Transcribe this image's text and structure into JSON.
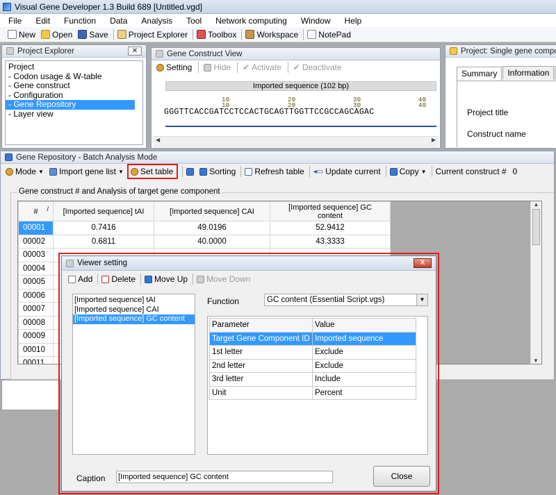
{
  "window": {
    "title": "Visual Gene Developer 1.3  Build 689  [Untitled.vgd]"
  },
  "menu": [
    "File",
    "Edit",
    "Function",
    "Data",
    "Analysis",
    "Tool",
    "Network computing",
    "Window",
    "Help"
  ],
  "toolbar": {
    "new": "New",
    "open": "Open",
    "save": "Save",
    "project_explorer": "Project Explorer",
    "toolbox": "Toolbox",
    "workspace": "Workspace",
    "notepad": "NotePad"
  },
  "project_explorer": {
    "title": "Project Explorer",
    "close": "✕",
    "items": [
      "Project",
      " - Codon usage & W-table",
      " - Gene construct",
      " - Configuration",
      " - Gene Repository",
      " - Layer view"
    ]
  },
  "gene_construct_view": {
    "title": "Gene Construct View",
    "tools": {
      "setting": "Setting",
      "hide": "Hide",
      "activate": "Activate",
      "deactivate": "Deactivate"
    },
    "sequence_label": "Imported sequence (102 bp)",
    "ruler_top": [
      "10",
      "20",
      "30",
      "40"
    ],
    "ruler_bottom": [
      "10",
      "20",
      "30",
      "40"
    ],
    "sequence": "GGGTTCACCGATCCTCCACTGCAGTTGGTTCCGCCAGCAGAC"
  },
  "project_panel": {
    "title": "Project:  Single gene compone",
    "tabs": [
      "Summary",
      "Information",
      "Sa"
    ],
    "fields": {
      "project_title": "Project title",
      "construct_name": "Construct name"
    }
  },
  "gene_repository": {
    "title": "Gene Repository - Batch Analysis Mode",
    "tools": {
      "mode": "Mode",
      "import_gene_list": "Import gene list",
      "set_table": "Set table",
      "sorting": "Sorting",
      "refresh_table": "Refresh table",
      "update_current": "Update current",
      "copy": "Copy",
      "current_construct": "Current construct #",
      "current_construct_value": "0"
    },
    "group_label": "Gene construct # and  Analysis of target gene component",
    "columns": {
      "num": "#",
      "sort": "/",
      "tai": "[Imported sequence] tAI",
      "cai": "[Imported sequence] CAI",
      "gc": "[Imported sequence] GC content"
    },
    "rows": [
      {
        "id": "00001",
        "tai": "0.7416",
        "cai": "49.0196",
        "gc": "52.9412"
      },
      {
        "id": "00002",
        "tai": "0.6811",
        "cai": "40.0000",
        "gc": "43.3333"
      },
      {
        "id": "00003",
        "tai": "",
        "cai": "",
        "gc": ""
      },
      {
        "id": "00004",
        "tai": "",
        "cai": "",
        "gc": ""
      },
      {
        "id": "00005",
        "tai": "",
        "cai": "",
        "gc": ""
      },
      {
        "id": "00006",
        "tai": "",
        "cai": "",
        "gc": ""
      },
      {
        "id": "00007",
        "tai": "",
        "cai": "",
        "gc": ""
      },
      {
        "id": "00008",
        "tai": "",
        "cai": "",
        "gc": ""
      },
      {
        "id": "00009",
        "tai": "",
        "cai": "",
        "gc": ""
      },
      {
        "id": "00010",
        "tai": "",
        "cai": "",
        "gc": ""
      },
      {
        "id": "00011",
        "tai": "",
        "cai": "",
        "gc": ""
      }
    ]
  },
  "viewer_setting": {
    "title": "Viewer setting",
    "close": "X",
    "tools": {
      "add": "Add",
      "delete": "Delete",
      "move_up": "Move Up",
      "move_down": "Move Down"
    },
    "list": [
      "[Imported sequence] tAI",
      "[Imported sequence] CAI",
      "[Imported sequence] GC content"
    ],
    "function_label": "Function",
    "function_value": "GC content (Essential Script.vgs)",
    "param_header": "Parameter",
    "value_header": "Value",
    "params": [
      {
        "name": "Target Gene Component ID",
        "value": "Imported sequence"
      },
      {
        "name": "1st letter",
        "value": "Exclude"
      },
      {
        "name": "2nd letter",
        "value": "Exclude"
      },
      {
        "name": "3rd letter",
        "value": "Include"
      },
      {
        "name": "Unit",
        "value": "Percent"
      }
    ],
    "caption_label": "Caption",
    "caption_value": "[Imported sequence] GC content",
    "close_button": "Close"
  }
}
